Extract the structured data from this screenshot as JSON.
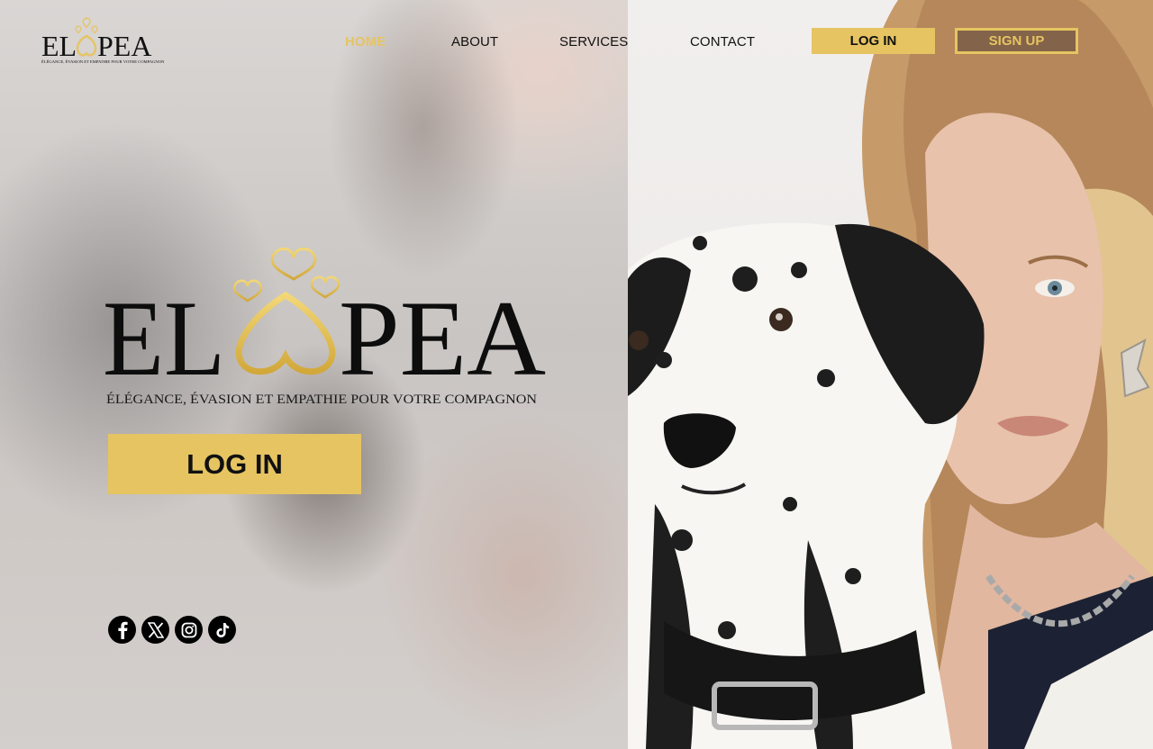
{
  "brand": {
    "name": "ELOPEA",
    "name_left": "EL",
    "name_right": "PEA",
    "tagline": "ÉLÉGANCE, ÉVASION ET EMPATHIE POUR VOTRE COMPAGNON",
    "accent_color": "#e6c462"
  },
  "nav": {
    "items": [
      {
        "label": "HOME",
        "active": true
      },
      {
        "label": "ABOUT",
        "active": false
      },
      {
        "label": "SERVICES",
        "active": false
      },
      {
        "label": "CONTACT",
        "active": false
      }
    ]
  },
  "header_actions": {
    "login_label": "LOG IN",
    "signup_label": "SIGN UP"
  },
  "hero": {
    "login_label": "LOG IN"
  },
  "socials": [
    {
      "name": "facebook-icon"
    },
    {
      "name": "x-twitter-icon"
    },
    {
      "name": "instagram-icon"
    },
    {
      "name": "tiktok-icon"
    }
  ],
  "photo": {
    "subject": "woman-with-dalmatian"
  }
}
